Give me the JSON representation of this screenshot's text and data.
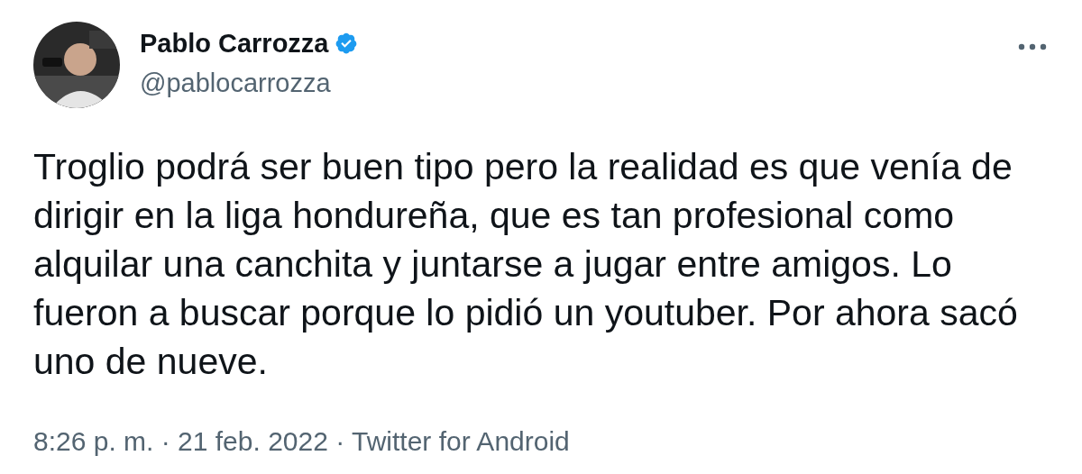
{
  "author": {
    "name": "Pablo Carrozza",
    "verified": true,
    "handle": "@pablocarrozza"
  },
  "text": "Troglio podrá ser buen tipo pero la realidad es que venía de dirigir en la liga hondureña, que es tan profesional como alquilar una canchita y juntarse a jugar entre amigos. Lo fueron a buscar porque lo pidió un youtuber. Por ahora sacó uno de nueve.",
  "footer": "8:26 p. m. · 21 feb. 2022 · Twitter for Android"
}
